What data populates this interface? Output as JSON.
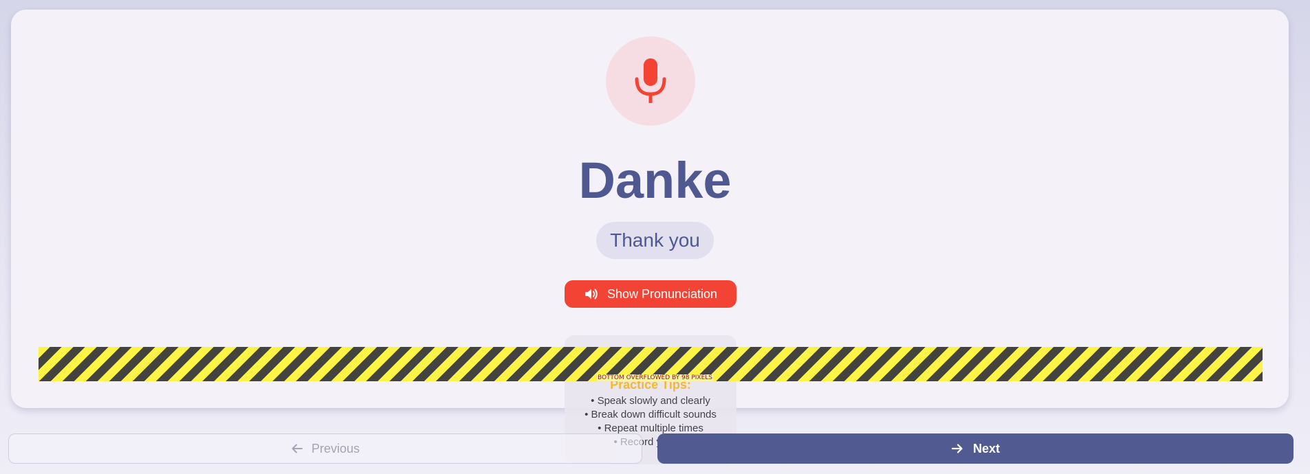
{
  "card": {
    "word": "Danke",
    "translation": "Thank you",
    "pronunciation_button": {
      "label": "Show Pronunciation",
      "icon": "volume-icon"
    },
    "mic_icon": "microphone-icon"
  },
  "tips": {
    "title": "Practice Tips:",
    "items": [
      "• Speak slowly and clearly",
      "• Break down difficult sounds",
      "• Repeat multiple times",
      "• Record yourse"
    ]
  },
  "overflow": {
    "label": "BOTTOM OVERFLOWED BY 98 PIXELS"
  },
  "navigation": {
    "previous": {
      "label": "Previous",
      "icon": "arrow-left-icon"
    },
    "next": {
      "label": "Next",
      "icon": "arrow-right-icon"
    }
  },
  "colors": {
    "accent_red": "#f24334",
    "primary": "#515a91",
    "tips_title": "#f3b322",
    "mic_background": "#f6dde3"
  }
}
